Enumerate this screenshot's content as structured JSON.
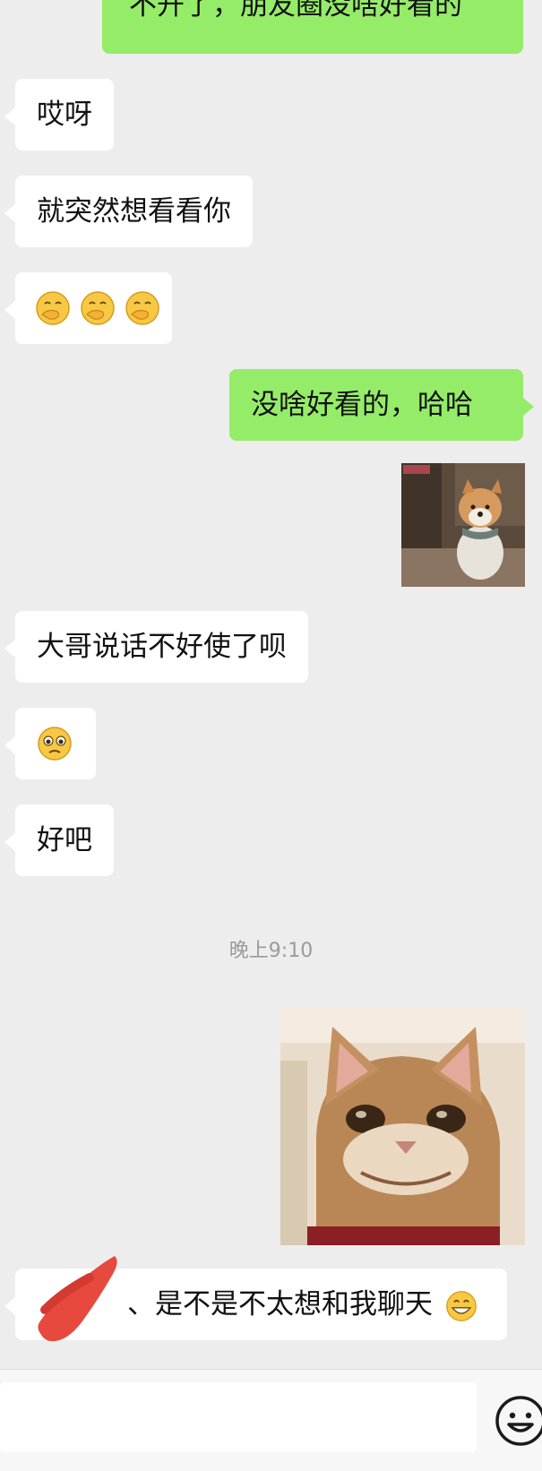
{
  "messages": {
    "top_partial": {
      "text": "不开了，朋友圈没啥好看的",
      "sender": "me"
    },
    "m1": {
      "text": "哎呀",
      "sender": "them"
    },
    "m2": {
      "text": "就突然想看看你",
      "sender": "them"
    },
    "m3": {
      "emojis": [
        "face-with-hand-over-mouth-emoji",
        "face-with-hand-over-mouth-emoji",
        "face-with-hand-over-mouth-emoji"
      ],
      "sender": "them"
    },
    "m4": {
      "text": "没啥好看的，哈哈",
      "sender": "me"
    },
    "m5": {
      "image": "shiba-dog-photo",
      "sender": "me"
    },
    "m6": {
      "text": "大哥说话不好使了呗",
      "sender": "them"
    },
    "m7": {
      "emojis": [
        "pleading-face-emoji"
      ],
      "sender": "them"
    },
    "m8": {
      "text": "好吧",
      "sender": "them"
    },
    "timestamp": "晚上9:10",
    "m9": {
      "image": "smiling-cat-photo",
      "sender": "me"
    },
    "m10": {
      "text": "、是不是不太想和我聊天",
      "emoji": "grinning-face-emoji",
      "sender": "them"
    }
  },
  "input_bar": {
    "emoji_button_icon": "smiley-icon"
  },
  "colors": {
    "background": "#ededed",
    "incoming": "#ffffff",
    "outgoing": "#95ec69",
    "redaction": "#e8493f"
  }
}
